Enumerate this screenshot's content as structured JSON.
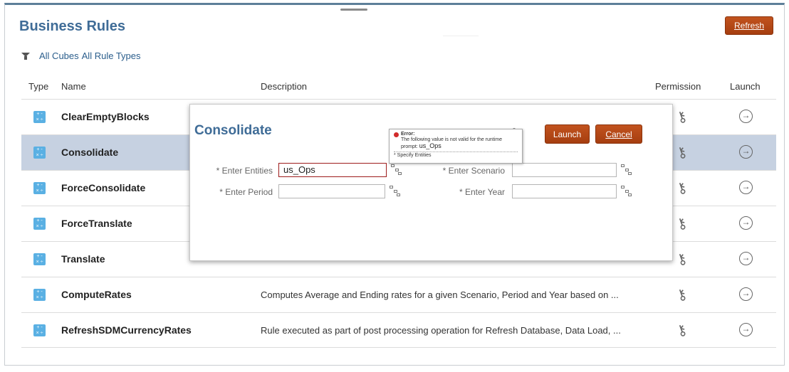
{
  "header": {
    "title": "Business Rules",
    "refresh_label": "Refresh"
  },
  "filters": {
    "cubes": "All Cubes",
    "rule_types": "All Rule Types"
  },
  "columns": {
    "type": "Type",
    "name": "Name",
    "description": "Description",
    "permission": "Permission",
    "launch": "Launch"
  },
  "rules": [
    {
      "name": "ClearEmptyBlocks",
      "description": ""
    },
    {
      "name": "Consolidate",
      "description": ""
    },
    {
      "name": "ForceConsolidate",
      "description": ""
    },
    {
      "name": "ForceTranslate",
      "description": ""
    },
    {
      "name": "Translate",
      "description": ""
    },
    {
      "name": "ComputeRates",
      "description": "Computes Average and Ending rates for a given Scenario, Period and Year based on ..."
    },
    {
      "name": "RefreshSDMCurrencyRates",
      "description": "Rule executed as part of post processing operation for Refresh Database, Data Load, ..."
    }
  ],
  "icons": {
    "type": "calculator-icon",
    "permission": "key-icon",
    "launch": "launch-arrow-icon"
  },
  "dialog": {
    "title": "Consolidate",
    "launch_label": "Launch",
    "cancel_label": "Cancel",
    "fields": {
      "entities": {
        "label": "* Enter Entities",
        "value": "us_Ops"
      },
      "scenario": {
        "label": "* Enter Scenario",
        "value": ""
      },
      "period": {
        "label": "* Enter Period",
        "value": ""
      },
      "year": {
        "label": "* Enter Year",
        "value": ""
      }
    },
    "error": {
      "title": "Error:",
      "message": "The following value is not valid for the runtime prompt:",
      "value": "us_Ops",
      "hint": "* Specify Entities"
    }
  },
  "colors": {
    "accent": "#b8491a",
    "title_blue": "#3f6c97",
    "selected_row": "#c6d1e1",
    "type_icon": "#5ab0e3",
    "error_border": "#9e1c1c"
  }
}
